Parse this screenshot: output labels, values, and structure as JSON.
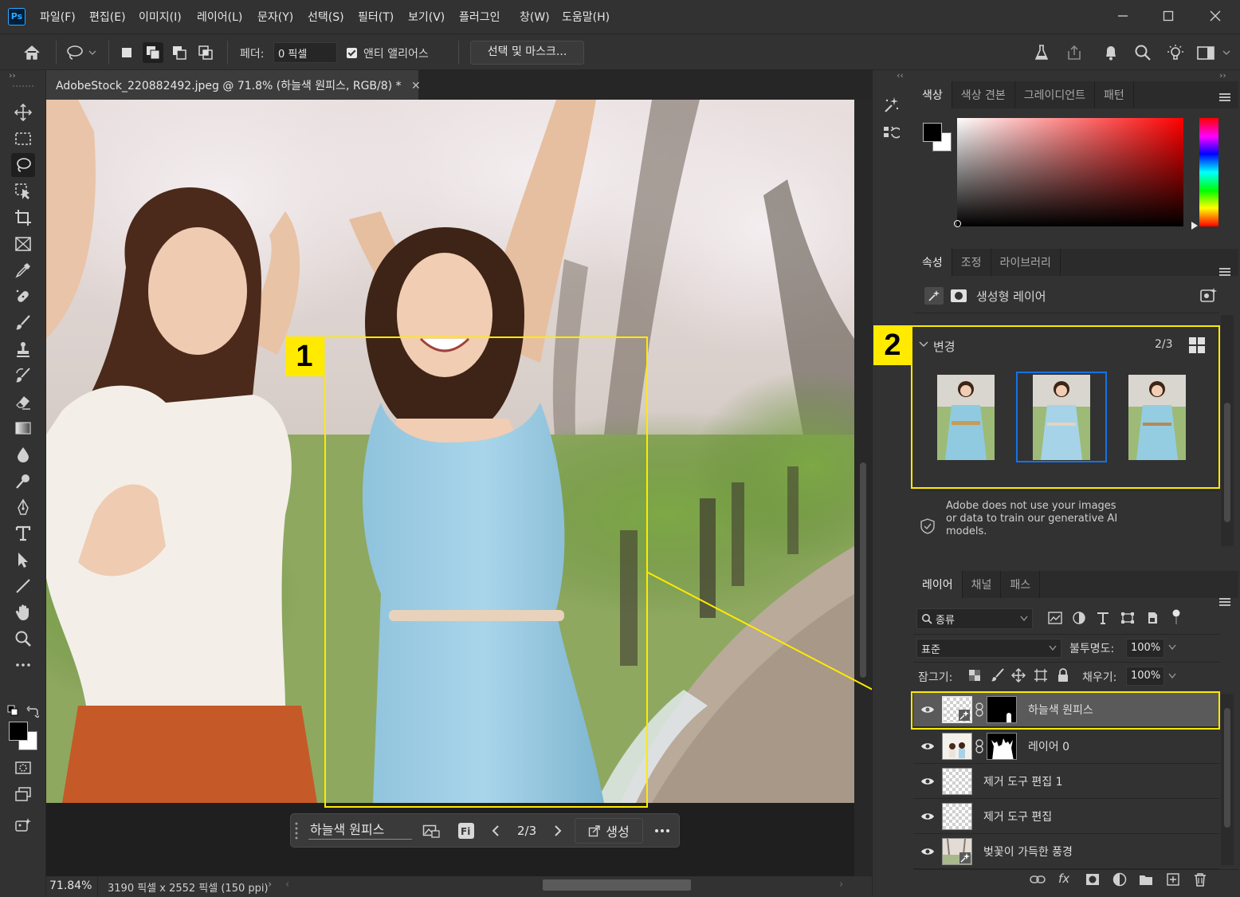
{
  "app": {
    "logo": "Ps",
    "menu": [
      "파일(F)",
      "편집(E)",
      "이미지(I)",
      "레이어(L)",
      "문자(Y)",
      "선택(S)",
      "필터(T)",
      "보기(V)",
      "플러그인",
      "창(W)",
      "도움말(H)"
    ]
  },
  "options_bar": {
    "feather_label": "페더:",
    "feather_value": "0 픽셀",
    "antialias_label": "앤티 앨리어스",
    "antialias_checked": true,
    "select_mask_button": "선택 및 마스크..."
  },
  "document": {
    "tab_title": "AdobeStock_220882492.jpeg @ 71.8% (하늘색 원피스, RGB/8) *",
    "zoom": "71.84%",
    "doc_info": "3190 픽셀 x 2552 픽셀 (150 ppi)"
  },
  "task_bar": {
    "prompt": "하늘색 원피스",
    "variation": "2/3",
    "generate_label": "생성"
  },
  "annotations": {
    "box1": "1",
    "box2": "2",
    "color": "#ffea00"
  },
  "color_panel": {
    "tabs": [
      "색상",
      "색상 견본",
      "그레이디언트",
      "패턴"
    ],
    "foreground": "#000000",
    "background": "#ffffff",
    "hue_color": "#ff0000"
  },
  "properties_panel": {
    "tabs": [
      "속성",
      "조정",
      "라이브러리"
    ],
    "layer_type": "생성형 레이어",
    "variations_label": "변경",
    "variations_count": "2/3",
    "selected_variation": 2,
    "notice": "Adobe does not use your images or data to train our generative AI models."
  },
  "layers_panel": {
    "tabs": [
      "레이어",
      "채널",
      "패스"
    ],
    "filter_kind": "종류",
    "blend_mode": "표준",
    "opacity_label": "불투명도:",
    "opacity_value": "100%",
    "lock_label": "잠그기:",
    "fill_label": "채우기:",
    "fill_value": "100%",
    "layers": [
      {
        "name": "하늘색 원피스",
        "selected": true
      },
      {
        "name": "레이어 0",
        "selected": false
      },
      {
        "name": "제거 도구 편집 1",
        "selected": false
      },
      {
        "name": "제거 도구 편집",
        "selected": false
      },
      {
        "name": "벚꽃이 가득한 풍경",
        "selected": false
      }
    ]
  }
}
